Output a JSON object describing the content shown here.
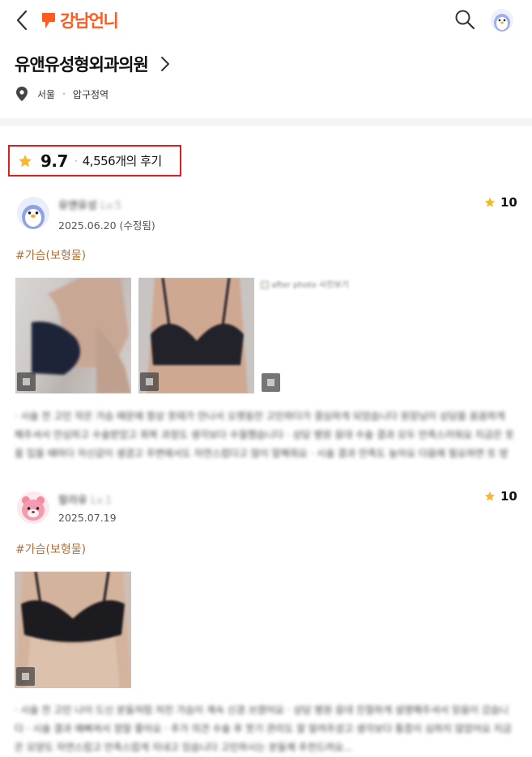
{
  "header": {
    "logo_text": "강남언니",
    "accent": "#ff5a1f"
  },
  "hospital": {
    "name": "유앤유성형외과의원",
    "city": "서울",
    "separator": "·",
    "area": "압구정역"
  },
  "rating": {
    "score": "9.7",
    "separator": "·",
    "count_label": "4,556개의 후기",
    "star_color": "#f7b731"
  },
  "reviews": [
    {
      "author": "유앤유성",
      "level": "Lv.5",
      "date": "2025.06.20 (수정됨)",
      "score": "10",
      "tag": "#가슴(보형물)",
      "broken_image_alt": "after photo 사진보기",
      "body": "· 시술 전 고민 작은 가슴 때문에 항상 옷태가 안나서 오랫동안 고민하다가 결심하게 되었습니다 원장님이 상담을 꼼꼼하게 해주셔서 안심하고 수술받았고 회복 과정도 생각보다 수월했습니다 · 상담 병원 응대 수술 결과 모두 만족스러워요 지금은 옷을 입을 때마다 자신감이 생겼고 주변에서도 자연스럽다고 많이 말해줘요 · 시술 결과 만족도 높아요 다음에 필요하면 또 방문하고 싶어요 원장님 감사합니다..."
    },
    {
      "author": "랄라유",
      "level": "Lv.1",
      "date": "2025.07.19",
      "score": "10",
      "tag": "#가슴(보형물)",
      "body": "· 시술 전 고민 나이 드신 분들처럼 처진 가슴이 계속 신경 쓰였어요 · 상담 병원 응대 친절하게 설명해주셔서 믿음이 갔습니다 · 시술 결과 예뻐져서 정말 좋아요 · 추가 의견 수술 후 붓기 관리도 잘 알려주셨고 생각보다 통증이 심하지 않았어요 지금은 모양도 자연스럽고 만족스럽게 지내고 있습니다 고민하시는 분들께 추천드려요..."
    }
  ]
}
